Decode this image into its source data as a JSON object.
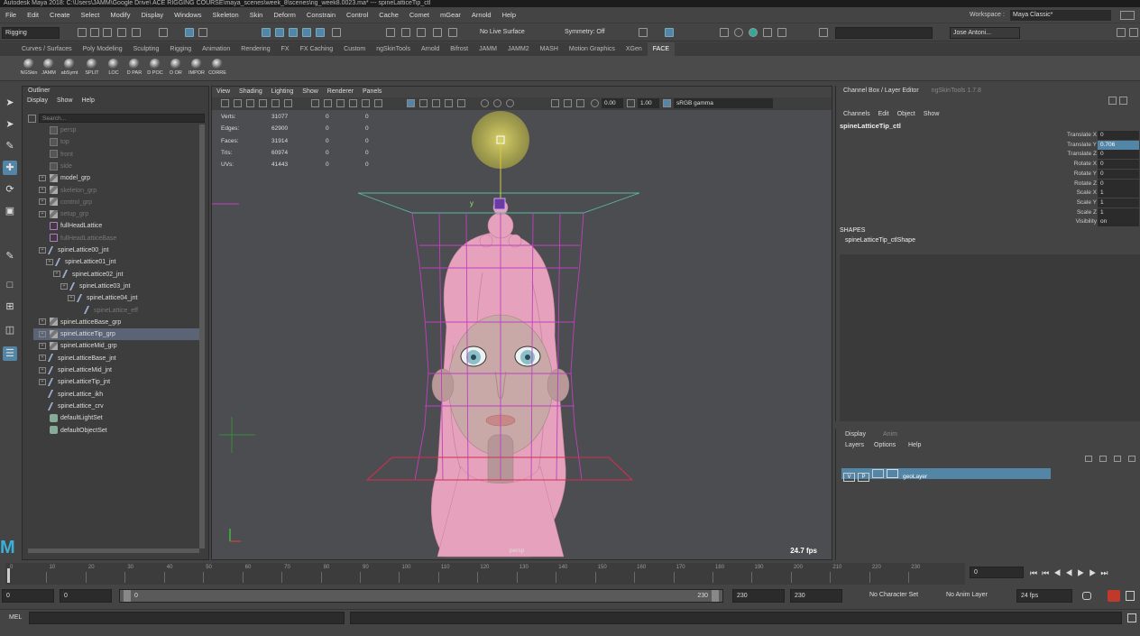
{
  "window": {
    "title": "Autodesk Maya 2018: C:\\Users\\JAMM\\Google Drive\\ ACE RIGGING COURSE\\maya_scenes\\week_8\\scenes\\rig_week8.0023.ma* --- spineLatticeTip_ctl"
  },
  "menus": [
    "File",
    "Edit",
    "Create",
    "Select",
    "Modify",
    "Display",
    "Windows",
    "Skeleton",
    "Skin",
    "Deform",
    "Constrain",
    "Control",
    "Cache",
    "Comet",
    "mGear",
    "Arnold",
    "Help"
  ],
  "workspace": {
    "label": "Workspace :",
    "value": "Maya Classic*"
  },
  "status": {
    "mode": "Rigging",
    "live_surface": "No Live Surface",
    "symmetry": "Symmetry: Off",
    "user": "Jose Antoni..."
  },
  "shelf_tabs": [
    "Curves / Surfaces",
    "Poly Modeling",
    "Sculpting",
    "Rigging",
    "Animation",
    "Rendering",
    "FX",
    "FX Caching",
    "Custom",
    "ngSkinTools",
    "Arnold",
    "Bifrost",
    "JAMM",
    "JAMM2",
    "MASH",
    "Motion Graphics",
    "XGen",
    "FACE"
  ],
  "shelf_active": "FACE",
  "shelf_buttons": [
    "NGSkin",
    "JAMM",
    "abSymt",
    "SPLIT",
    "LOC",
    "D PAR",
    "D POC",
    "D OR",
    "IMPOR",
    "CORRE"
  ],
  "outliner": {
    "title": "Outliner",
    "menu": [
      "Display",
      "Show",
      "Help"
    ],
    "search_placeholder": "Search...",
    "items": [
      {
        "label": "persp",
        "dim": true
      },
      {
        "label": "top",
        "dim": true
      },
      {
        "label": "front",
        "dim": true
      },
      {
        "label": "side",
        "dim": true
      },
      {
        "label": "model_grp",
        "dim": false
      },
      {
        "label": "skeleton_grp",
        "dim": true
      },
      {
        "label": "control_grp",
        "dim": true
      },
      {
        "label": "setup_grp",
        "dim": true
      },
      {
        "label": "fullHeadLattice",
        "dim": false
      },
      {
        "label": "fullHeadLatticeBase",
        "dim": true
      },
      {
        "label": "spineLattice00_jnt",
        "dim": false
      },
      {
        "label": "spineLattice01_jnt",
        "dim": false
      },
      {
        "label": "spineLattice02_jnt",
        "dim": false
      },
      {
        "label": "spineLattice03_jnt",
        "dim": false
      },
      {
        "label": "spineLattice04_jnt",
        "dim": false
      },
      {
        "label": "spineLattice_eff",
        "dim": true
      },
      {
        "label": "spineLatticeBase_grp",
        "dim": false
      },
      {
        "label": "spineLatticeTip_grp",
        "dim": false
      },
      {
        "label": "spineLatticeMid_grp",
        "dim": false
      },
      {
        "label": "spineLatticeBase_jnt",
        "dim": false
      },
      {
        "label": "spineLatticeMid_jnt",
        "dim": false
      },
      {
        "label": "spineLatticeTip_jnt",
        "dim": false
      },
      {
        "label": "spineLattice_ikh",
        "dim": false
      },
      {
        "label": "spineLattice_crv",
        "dim": false
      },
      {
        "label": "defaultLightSet",
        "dim": false
      },
      {
        "label": "defaultObjectSet",
        "dim": false
      }
    ]
  },
  "viewport": {
    "menu": [
      "View",
      "Shading",
      "Lighting",
      "Show",
      "Renderer",
      "Panels"
    ],
    "exposure": "0.00",
    "gamma": "1.00",
    "colorspace": "sRGB gamma",
    "hud": [
      {
        "label": "Verts:",
        "a": "31077",
        "b": "0",
        "c": "0"
      },
      {
        "label": "Edges:",
        "a": "62900",
        "b": "0",
        "c": "0"
      },
      {
        "label": "Faces:",
        "a": "31914",
        "b": "0",
        "c": "0"
      },
      {
        "label": "Tris:",
        "a": "60974",
        "b": "0",
        "c": "0"
      },
      {
        "label": "UVs:",
        "a": "41443",
        "b": "0",
        "c": "0"
      }
    ],
    "camera": "persp",
    "fps": "24.7 fps",
    "axis_label": "y"
  },
  "channel_box": {
    "tabs": [
      "Channel Box / Layer Editor",
      "ngSkinTools 1.7.8"
    ],
    "menu": [
      "Channels",
      "Edit",
      "Object",
      "Show"
    ],
    "object": "spineLatticeTip_ctl",
    "attrs": [
      {
        "name": "Translate X",
        "value": "0"
      },
      {
        "name": "Translate Y",
        "value": "0.706"
      },
      {
        "name": "Translate Z",
        "value": "0"
      },
      {
        "name": "Rotate X",
        "value": "0"
      },
      {
        "name": "Rotate Y",
        "value": "0"
      },
      {
        "name": "Rotate Z",
        "value": "0"
      },
      {
        "name": "Scale X",
        "value": "1"
      },
      {
        "name": "Scale Y",
        "value": "1"
      },
      {
        "name": "Scale Z",
        "value": "1"
      },
      {
        "name": "Visibility",
        "value": "on"
      }
    ],
    "shapes_title": "SHAPES",
    "shape_name": "spineLatticeTip_ctlShape"
  },
  "layer_editor": {
    "tabs": [
      "Display",
      "Anim"
    ],
    "menu": [
      "Layers",
      "Options",
      "Help"
    ],
    "layer": {
      "v": "V",
      "p": "P",
      "name": "geoLayer"
    }
  },
  "time_slider": {
    "ticks": [
      "0",
      "10",
      "20",
      "30",
      "40",
      "50",
      "60",
      "70",
      "80",
      "90",
      "100",
      "110",
      "120",
      "130",
      "140",
      "150",
      "160",
      "170",
      "180",
      "190",
      "200",
      "210",
      "220",
      "230"
    ],
    "current_frame": "0"
  },
  "range_slider": {
    "start": "0",
    "anim_start": "0",
    "range_lo": "0",
    "range_hi": "230",
    "anim_end": "230",
    "end": "230",
    "char_set": "No Character Set",
    "anim_layer": "No Anim Layer",
    "fps": "24 fps"
  },
  "command_line": {
    "label": "MEL"
  },
  "colors": {
    "accent": "#5285a6",
    "lattice": "#c040c0",
    "skin": "#e6a2bc"
  }
}
